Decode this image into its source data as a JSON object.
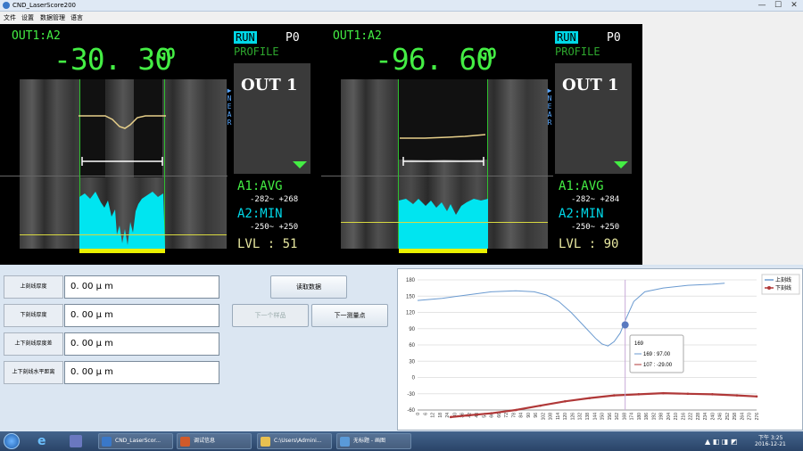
{
  "window": {
    "title": "CND_LaserScore200",
    "min": "—",
    "max": "☐",
    "close": "✕"
  },
  "menu": [
    "文件",
    "设置",
    "数据管理",
    "语言"
  ],
  "panels": [
    {
      "out": "OUT1:A2",
      "value": "-30. 30",
      "go": "GO",
      "run": "RUN",
      "p": "P0",
      "profile": "PROFILE",
      "outname": "OUT 1",
      "near": "▶ N E A R",
      "a1": "A1:AVG",
      "a1range": "-282~ +268",
      "a2": "A2:MIN",
      "a2range": "-250~ +250",
      "lvl": "LVL : 51"
    },
    {
      "out": "OUT1:A2",
      "value": "-96. 60",
      "go": "GO",
      "run": "RUN",
      "p": "P0",
      "profile": "PROFILE",
      "outname": "OUT 1",
      "near": "▶ N E A R",
      "a1": "A1:AVG",
      "a1range": "-282~ +284",
      "a2": "A2:MIN",
      "a2range": "-250~ +250",
      "lvl": "LVL : 90"
    }
  ],
  "fields": [
    {
      "label": "上刻线厚度",
      "value": "0. 00 μ m"
    },
    {
      "label": "下刻线厚度",
      "value": "0. 00 μ m"
    },
    {
      "label": "上下刻线厚度差",
      "value": "0. 00 μ m"
    },
    {
      "label": "上下刻线水平距离",
      "value": "0. 00 μ m"
    }
  ],
  "buttons": {
    "read": "读取数据",
    "next_sample": "下一个样品",
    "next_point": "下一测量点"
  },
  "chart_data": {
    "type": "line",
    "ylim": [
      -60,
      180
    ],
    "yticks": [
      "180",
      "150",
      "120",
      "90",
      "60",
      "30",
      "0",
      "-30",
      "-60"
    ],
    "xticks": [
      "0",
      "6",
      "12",
      "18",
      "24",
      "30",
      "36",
      "42",
      "48",
      "54",
      "60",
      "66",
      "72",
      "78",
      "84",
      "90",
      "96",
      "102",
      "108",
      "114",
      "120",
      "126",
      "132",
      "138",
      "144",
      "150",
      "156",
      "162",
      "168",
      "174",
      "180",
      "186",
      "192",
      "198",
      "204",
      "210",
      "216",
      "222",
      "228",
      "234",
      "240",
      "246",
      "252",
      "258",
      "264",
      "270",
      "276"
    ],
    "series": [
      {
        "name": "上刻线",
        "color": "#6a9ad0",
        "x": [
          0,
          20,
          40,
          60,
          80,
          95,
          105,
          115,
          125,
          135,
          145,
          150,
          155,
          160,
          165,
          170,
          176,
          185,
          200,
          220,
          240,
          250
        ],
        "values": [
          142,
          146,
          152,
          158,
          160,
          158,
          152,
          140,
          120,
          96,
          72,
          62,
          58,
          66,
          82,
          110,
          140,
          158,
          165,
          170,
          172,
          174
        ]
      },
      {
        "name": "下刻线",
        "color": "#b03838",
        "x": [
          27,
          40,
          60,
          80,
          100,
          120,
          140,
          160,
          180,
          200,
          220,
          240,
          260,
          276
        ],
        "values": [
          -73,
          -70,
          -66,
          -60,
          -52,
          -44,
          -38,
          -33,
          -31,
          -29,
          -30,
          -31,
          -33,
          -35
        ]
      }
    ],
    "cursor_x": 169,
    "tooltip": {
      "title": "169",
      "line1": "169 : 97.00",
      "line2": "107 : -29.00"
    }
  },
  "taskbar": {
    "items": [
      "CND_LaserScor...",
      "调试信息",
      "C:\\Users\\Admini...",
      "无标题 - 画图"
    ],
    "time": "下午 3:25",
    "date": "2016-12-21"
  }
}
